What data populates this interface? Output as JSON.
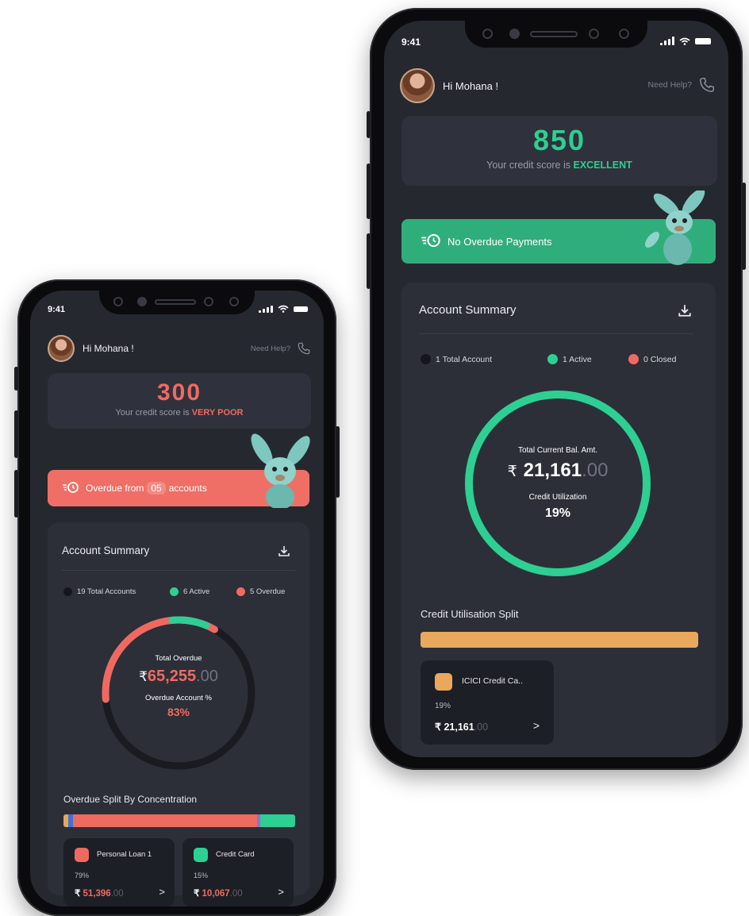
{
  "phone_left": {
    "status_time": "9:41",
    "greeting": "Hi Mohana !",
    "help_label": "Need Help?",
    "score": "300",
    "score_text": "Your credit score is",
    "score_rating": "VERY POOR",
    "banner_prefix": "Overdue from",
    "banner_count": "05",
    "banner_suffix": "accounts",
    "summary_title": "Account Summary",
    "legend": [
      {
        "label": "19 Total Accounts",
        "color": "#15161b"
      },
      {
        "label": "6 Active",
        "color": "#2ecf92"
      },
      {
        "label": "5 Overdue",
        "color": "#f06a62"
      }
    ],
    "ring_label": "Total Overdue",
    "ring_currency": "₹",
    "ring_amount": "65,255",
    "ring_decimals": ".00",
    "ring_sub_label": "Overdue Account %",
    "ring_sub_value": "83%",
    "split_title": "Overdue Split By Concentration",
    "tiles": [
      {
        "name": "Personal Loan 1",
        "pct": "79%",
        "currency": "₹",
        "amount": "51,396",
        "decimals": ".00",
        "arrow": ">"
      },
      {
        "name": "Credit Card",
        "pct": "15%",
        "currency": "₹",
        "amount": "10,067",
        "decimals": ".00",
        "arrow": ">"
      }
    ]
  },
  "phone_right": {
    "status_time": "9:41",
    "greeting": "Hi Mohana !",
    "help_label": "Need Help?",
    "score": "850",
    "score_text": "Your credit score is",
    "score_rating": "EXCELLENT",
    "banner_text": "No Overdue Payments",
    "summary_title": "Account Summary",
    "legend": [
      {
        "label": "1 Total Account",
        "color": "#15161b"
      },
      {
        "label": "1 Active",
        "color": "#2ecf92"
      },
      {
        "label": "0 Closed",
        "color": "#f06a62"
      }
    ],
    "ring_label": "Total Current Bal. Amt.",
    "ring_currency": "₹",
    "ring_amount": "21,161",
    "ring_decimals": ".00",
    "ring_sub_label": "Credit Utilization",
    "ring_sub_value": "19%",
    "split_title": "Credit Utilisation Split",
    "tiles": [
      {
        "name": "ICICI Credit Ca..",
        "pct": "19%",
        "currency": "₹",
        "amount": "21,161",
        "decimals": ".00",
        "arrow": ">"
      }
    ]
  },
  "colors": {
    "green": "#2ecf92",
    "red": "#f06a62",
    "orange": "#e9a85c",
    "screen_bg": "#262830"
  },
  "icons": {
    "download": "download-icon",
    "phone": "phone-icon",
    "overdue_clock": "clock-list-icon"
  }
}
